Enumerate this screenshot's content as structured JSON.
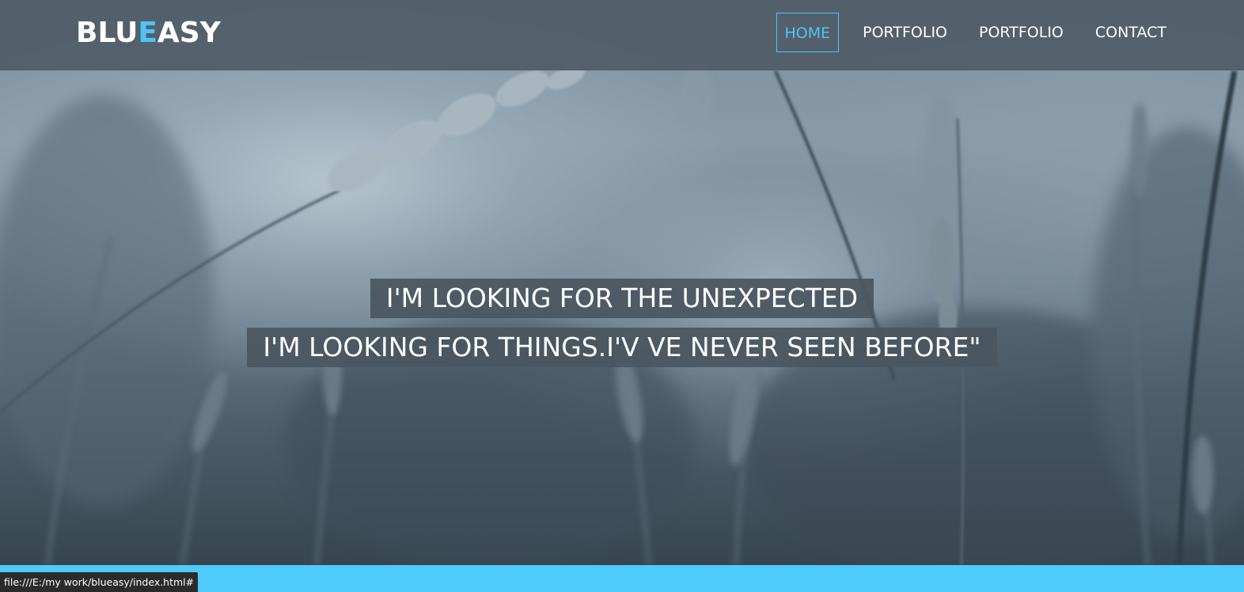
{
  "brand": {
    "logo_part1": "BLU",
    "logo_accent": "E",
    "logo_part2": "ASY",
    "accent_color": "#4dc4f5"
  },
  "nav": {
    "items": [
      {
        "label": "HOME",
        "active": true
      },
      {
        "label": "PORTFOLIO",
        "active": false
      },
      {
        "label": "PORTFOLIO",
        "active": false
      },
      {
        "label": "CONTACT",
        "active": false
      }
    ]
  },
  "hero": {
    "background": "blurred grass photo, desaturated blue-gray",
    "line1": "I'M LOOKING FOR THE UNEXPECTED",
    "line2": "I'M LOOKING FOR THINGS.I'V VE NEVER SEEN BEFORE\""
  },
  "status_bar": {
    "url": "file:///E:/my work/blueasy/index.html#"
  },
  "colors": {
    "navbar": "#505d68",
    "bottom_bar": "#4ecbfa",
    "caption_bg": "#4a5660"
  }
}
